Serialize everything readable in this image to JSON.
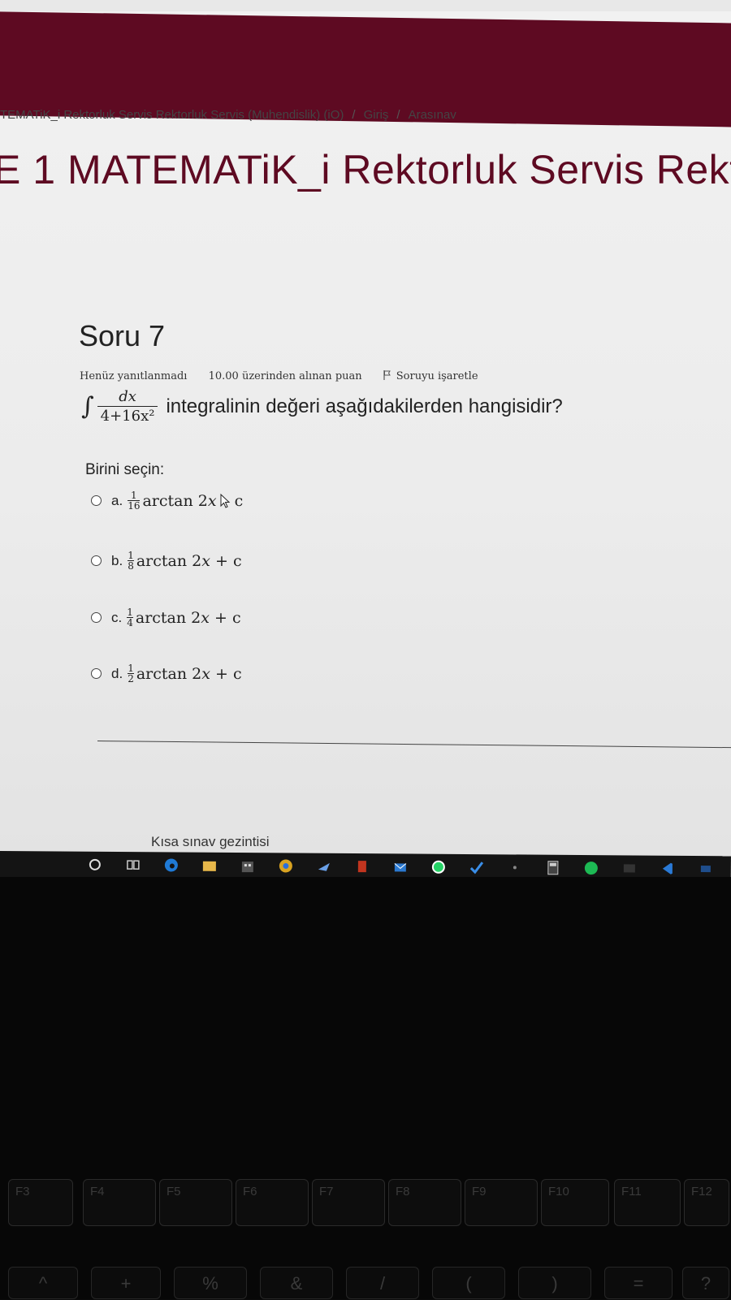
{
  "breadcrumb": {
    "course": "TEMATiK_i Rektorluk Servis Rektorluk Servis (Muhendislik) (iO)",
    "separator": "/",
    "section": "Giriş",
    "page": "Arasınav"
  },
  "course_title": "E 1 MATEMATiK_i Rektorluk Servis Rekt",
  "question": {
    "title": "Soru 7",
    "status": "Henüz yanıtlanmadı",
    "points": "10.00 üzerinden alınan puan",
    "flag_label": "Soruyu işaretle",
    "integral": {
      "symbol": "∫",
      "numerator": "dx",
      "denominator": "4+16x²"
    },
    "text": "integralinin değeri aşağıdakilerden hangisidir?",
    "choose_label": "Birini seçin:",
    "options": [
      {
        "letter": "a.",
        "num": "1",
        "den": "16",
        "expr_pre": "arctan 2",
        "var": "x",
        "expr_post": "c"
      },
      {
        "letter": "b.",
        "num": "1",
        "den": "8",
        "expr_pre": "arctan 2",
        "var": "x",
        "expr_post": "+ c"
      },
      {
        "letter": "c.",
        "num": "1",
        "den": "4",
        "expr_pre": "arctan 2",
        "var": "x",
        "expr_post": "+ c"
      },
      {
        "letter": "d.",
        "num": "1",
        "den": "2",
        "expr_pre": "arctan 2",
        "var": "x",
        "expr_post": "+ c"
      }
    ]
  },
  "quiz_nav_title": "Kısa sınav gezintisi",
  "colors": {
    "brand": "#5e0a22",
    "text": "#222222"
  },
  "taskbar_icons": [
    "windows-search-icon",
    "task-view-icon",
    "edge-icon",
    "file-explorer-icon",
    "store-icon",
    "chrome-icon",
    "arrow-app-icon",
    "office-icon",
    "mail-icon",
    "whatsapp-icon",
    "check-app-icon",
    "dot-app-icon",
    "calculator-icon",
    "spotify-icon",
    "settings-app-icon",
    "vs-code-icon",
    "extra-app-icon"
  ],
  "keyboard": {
    "fkeys": [
      "F3",
      "F4",
      "F5",
      "F6",
      "F7",
      "F8",
      "F9",
      "F10",
      "F11",
      "F12"
    ],
    "symbols": [
      "^",
      "+",
      "%",
      "&",
      "/",
      "(",
      ")",
      "=",
      "?"
    ]
  }
}
